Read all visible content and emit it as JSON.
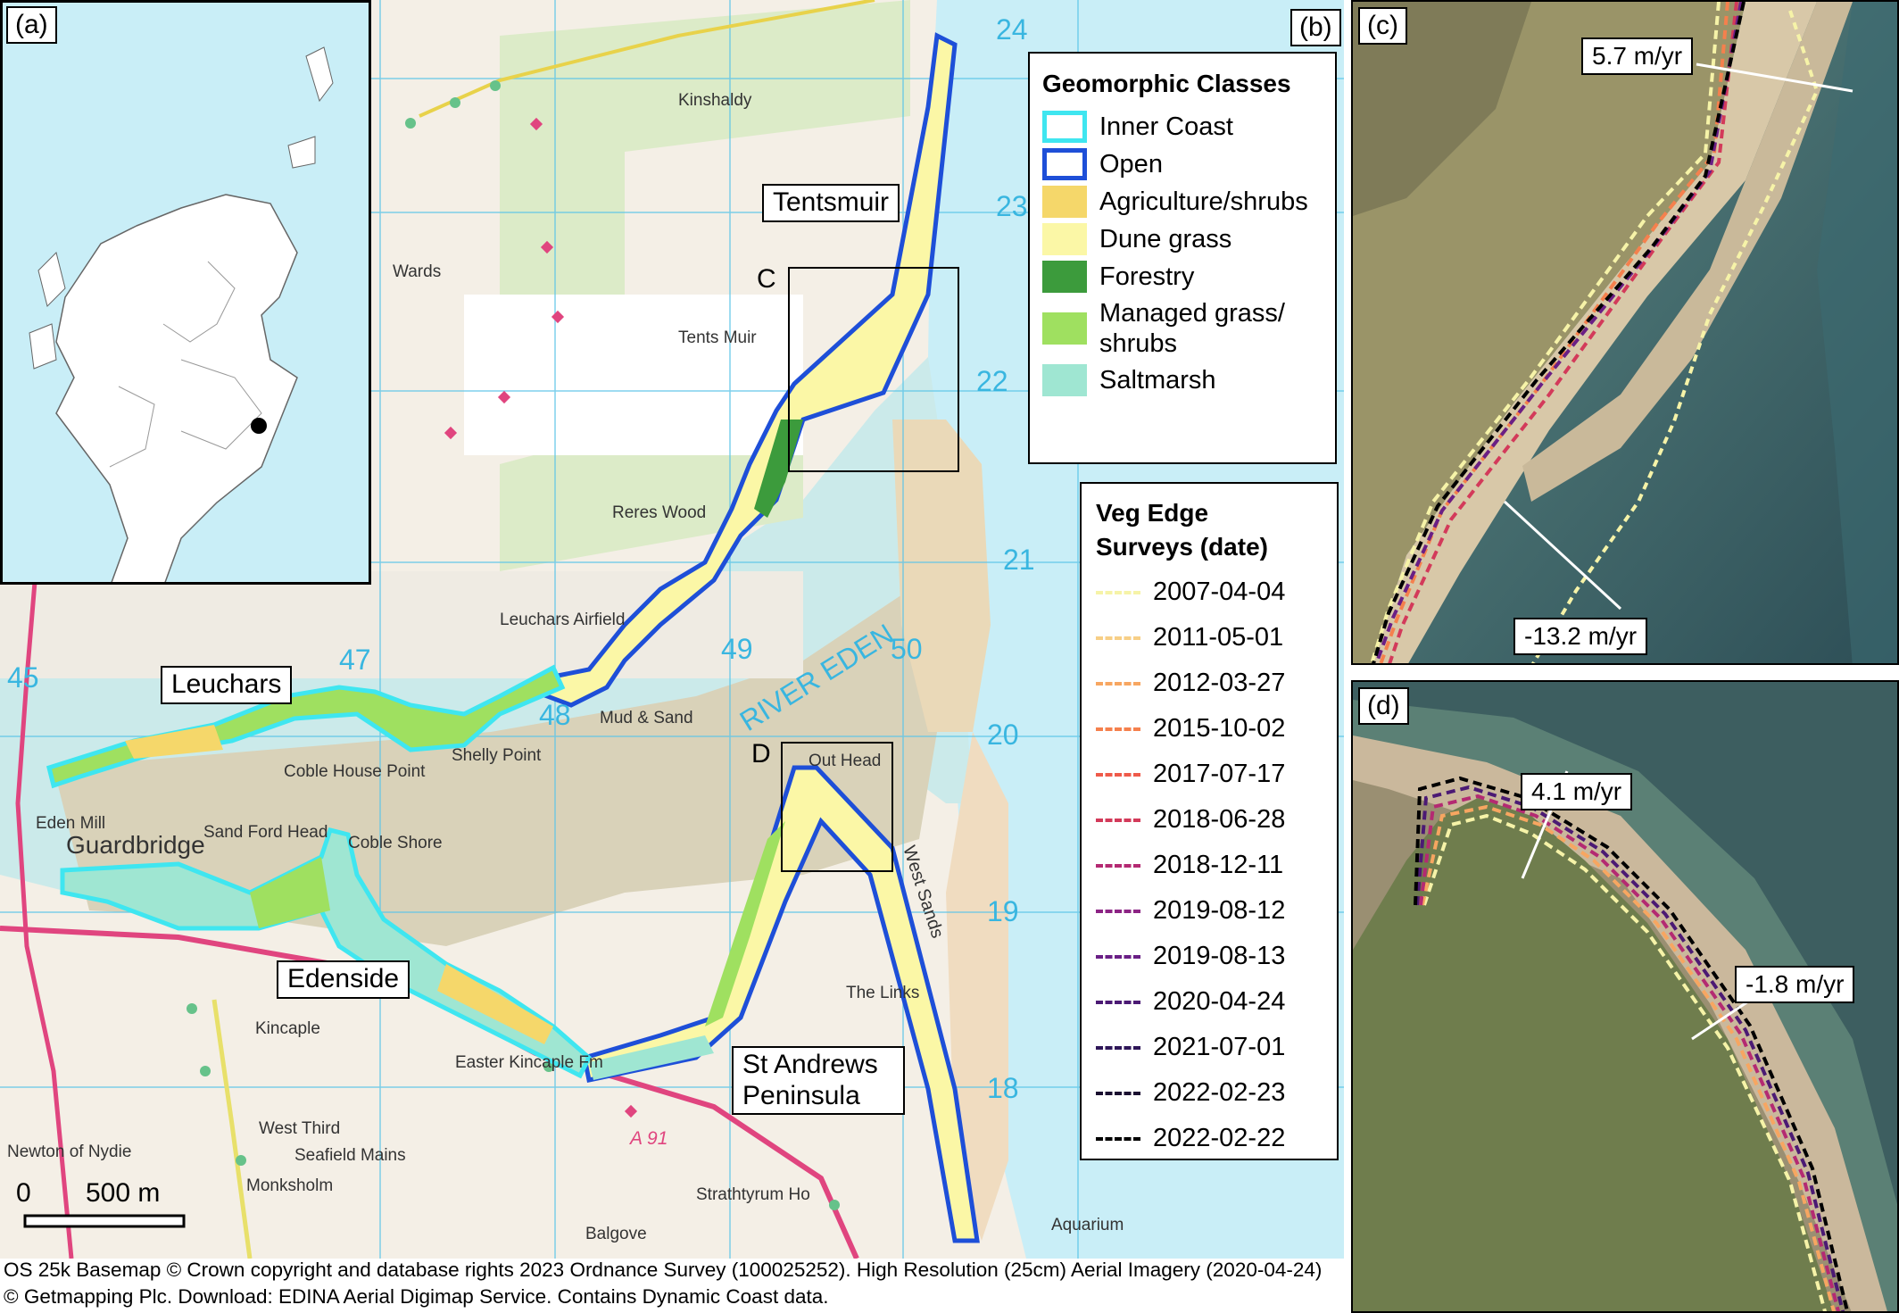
{
  "panels": {
    "a": "(a)",
    "b": "(b)",
    "c": "(c)",
    "d": "(d)"
  },
  "inset_boxes": {
    "c": "C",
    "d": "D"
  },
  "legend_classes": {
    "title": "Geomorphic Classes",
    "items": [
      {
        "label": "Inner Coast",
        "fill": "#ffffff",
        "stroke": "#3fe6f0",
        "thick": true
      },
      {
        "label": "Open",
        "fill": "#ffffff",
        "stroke": "#1e4fd8",
        "thick": true
      },
      {
        "label": "Agriculture/shrubs",
        "fill": "#f5d76a",
        "stroke": "none"
      },
      {
        "label": "Dune grass",
        "fill": "#fbf7a6",
        "stroke": "none"
      },
      {
        "label": "Forestry",
        "fill": "#3c9b3c",
        "stroke": "none"
      },
      {
        "label": "Managed grass/ shrubs",
        "fill": "#9fe060",
        "stroke": "none"
      },
      {
        "label": "Saltmarsh",
        "fill": "#9fe6d2",
        "stroke": "none"
      }
    ]
  },
  "legend_surveys": {
    "title": "Veg Edge Surveys (date)",
    "items": [
      {
        "date": "2007-04-04",
        "color": "#f6f3a8"
      },
      {
        "date": "2011-05-01",
        "color": "#f7cf86"
      },
      {
        "date": "2012-03-27",
        "color": "#f7a661"
      },
      {
        "date": "2015-10-02",
        "color": "#f5804d"
      },
      {
        "date": "2017-07-17",
        "color": "#ef5a4a"
      },
      {
        "date": "2018-06-28",
        "color": "#d33a5a"
      },
      {
        "date": "2018-12-11",
        "color": "#b42a72"
      },
      {
        "date": "2019-08-12",
        "color": "#8c2484"
      },
      {
        "date": "2019-08-13",
        "color": "#6a1f85"
      },
      {
        "date": "2020-04-24",
        "color": "#4b1a74"
      },
      {
        "date": "2021-07-01",
        "color": "#2e1658"
      },
      {
        "date": "2022-02-23",
        "color": "#1a0f30"
      },
      {
        "date": "2022-02-22",
        "color": "#000000"
      }
    ]
  },
  "place_labels": {
    "tentsmuir": "Tentsmuir",
    "leuchars": "Leuchars",
    "edenside": "Edenside",
    "st_andrews": "St Andrews Peninsula"
  },
  "map_text": {
    "kinshaldy": "Kinshaldy",
    "wards": "Wards",
    "tents_muir": "Tents Muir",
    "reres_wood": "Reres Wood",
    "leuchars_airfield": "Leuchars Airfield",
    "mud_sand": "Mud & Sand",
    "shelly_point": "Shelly Point",
    "coble_house_point": "Coble House Point",
    "river_eden": "RIVER EDEN",
    "eden_mill": "Eden Mill",
    "guardbridge": "Guardbridge",
    "sand_ford_head": "Sand Ford Head",
    "coble_shore": "Coble Shore",
    "out_head": "Out Head",
    "west_sands": "West Sands",
    "the_links": "The Links",
    "kincaple": "Kincaple",
    "easter_kincaple": "Easter Kincaple Fm",
    "west_third": "West Third",
    "seafield_mains": "Seafield Mains",
    "monksholm": "Monksholm",
    "newton_of_nydie": "Newton of Nydie",
    "strathtyrum": "Strathtyrum Ho",
    "balgove": "Balgove",
    "aquarium": "Aquarium",
    "a91": "A 91",
    "grid": [
      "24",
      "23",
      "22",
      "21",
      "20",
      "19",
      "18",
      "45",
      "47",
      "48",
      "49",
      "50"
    ]
  },
  "scale_bar": {
    "zero": "0",
    "distance": "500 m"
  },
  "rates": {
    "c_upper": "5.7 m/yr",
    "c_lower": "-13.2 m/yr",
    "d_upper": "4.1 m/yr",
    "d_lower": "-1.8 m/yr"
  },
  "credits": {
    "line1": "OS 25k Basemap © Crown copyright and database rights 2023 Ordnance Survey (100025252). High Resolution (25cm) Aerial Imagery (2020-04-24)",
    "line2": "© Getmapping Plc. Download: EDINA Aerial Digimap Service. Contains Dynamic Coast data."
  },
  "colors": {
    "inner_coast": "#3fe6f0",
    "open": "#1e4fd8",
    "sea": "#c9eef7",
    "estuary_sand": "#e9d9b6",
    "forest": "#dcebc8"
  }
}
